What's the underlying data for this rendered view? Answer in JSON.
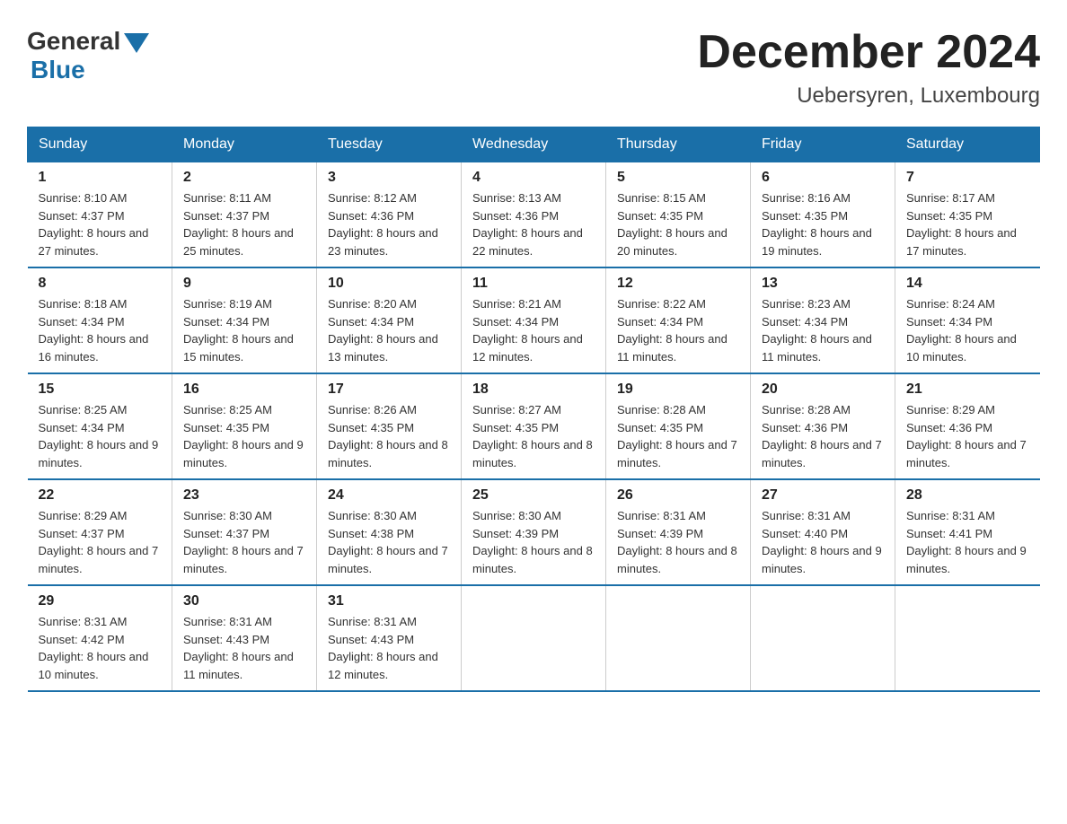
{
  "logo": {
    "general": "General",
    "blue": "Blue"
  },
  "title": "December 2024",
  "location": "Uebersyren, Luxembourg",
  "headers": [
    "Sunday",
    "Monday",
    "Tuesday",
    "Wednesday",
    "Thursday",
    "Friday",
    "Saturday"
  ],
  "weeks": [
    [
      {
        "day": "1",
        "sunrise": "8:10 AM",
        "sunset": "4:37 PM",
        "daylight": "8 hours and 27 minutes."
      },
      {
        "day": "2",
        "sunrise": "8:11 AM",
        "sunset": "4:37 PM",
        "daylight": "8 hours and 25 minutes."
      },
      {
        "day": "3",
        "sunrise": "8:12 AM",
        "sunset": "4:36 PM",
        "daylight": "8 hours and 23 minutes."
      },
      {
        "day": "4",
        "sunrise": "8:13 AM",
        "sunset": "4:36 PM",
        "daylight": "8 hours and 22 minutes."
      },
      {
        "day": "5",
        "sunrise": "8:15 AM",
        "sunset": "4:35 PM",
        "daylight": "8 hours and 20 minutes."
      },
      {
        "day": "6",
        "sunrise": "8:16 AM",
        "sunset": "4:35 PM",
        "daylight": "8 hours and 19 minutes."
      },
      {
        "day": "7",
        "sunrise": "8:17 AM",
        "sunset": "4:35 PM",
        "daylight": "8 hours and 17 minutes."
      }
    ],
    [
      {
        "day": "8",
        "sunrise": "8:18 AM",
        "sunset": "4:34 PM",
        "daylight": "8 hours and 16 minutes."
      },
      {
        "day": "9",
        "sunrise": "8:19 AM",
        "sunset": "4:34 PM",
        "daylight": "8 hours and 15 minutes."
      },
      {
        "day": "10",
        "sunrise": "8:20 AM",
        "sunset": "4:34 PM",
        "daylight": "8 hours and 13 minutes."
      },
      {
        "day": "11",
        "sunrise": "8:21 AM",
        "sunset": "4:34 PM",
        "daylight": "8 hours and 12 minutes."
      },
      {
        "day": "12",
        "sunrise": "8:22 AM",
        "sunset": "4:34 PM",
        "daylight": "8 hours and 11 minutes."
      },
      {
        "day": "13",
        "sunrise": "8:23 AM",
        "sunset": "4:34 PM",
        "daylight": "8 hours and 11 minutes."
      },
      {
        "day": "14",
        "sunrise": "8:24 AM",
        "sunset": "4:34 PM",
        "daylight": "8 hours and 10 minutes."
      }
    ],
    [
      {
        "day": "15",
        "sunrise": "8:25 AM",
        "sunset": "4:34 PM",
        "daylight": "8 hours and 9 minutes."
      },
      {
        "day": "16",
        "sunrise": "8:25 AM",
        "sunset": "4:35 PM",
        "daylight": "8 hours and 9 minutes."
      },
      {
        "day": "17",
        "sunrise": "8:26 AM",
        "sunset": "4:35 PM",
        "daylight": "8 hours and 8 minutes."
      },
      {
        "day": "18",
        "sunrise": "8:27 AM",
        "sunset": "4:35 PM",
        "daylight": "8 hours and 8 minutes."
      },
      {
        "day": "19",
        "sunrise": "8:28 AM",
        "sunset": "4:35 PM",
        "daylight": "8 hours and 7 minutes."
      },
      {
        "day": "20",
        "sunrise": "8:28 AM",
        "sunset": "4:36 PM",
        "daylight": "8 hours and 7 minutes."
      },
      {
        "day": "21",
        "sunrise": "8:29 AM",
        "sunset": "4:36 PM",
        "daylight": "8 hours and 7 minutes."
      }
    ],
    [
      {
        "day": "22",
        "sunrise": "8:29 AM",
        "sunset": "4:37 PM",
        "daylight": "8 hours and 7 minutes."
      },
      {
        "day": "23",
        "sunrise": "8:30 AM",
        "sunset": "4:37 PM",
        "daylight": "8 hours and 7 minutes."
      },
      {
        "day": "24",
        "sunrise": "8:30 AM",
        "sunset": "4:38 PM",
        "daylight": "8 hours and 7 minutes."
      },
      {
        "day": "25",
        "sunrise": "8:30 AM",
        "sunset": "4:39 PM",
        "daylight": "8 hours and 8 minutes."
      },
      {
        "day": "26",
        "sunrise": "8:31 AM",
        "sunset": "4:39 PM",
        "daylight": "8 hours and 8 minutes."
      },
      {
        "day": "27",
        "sunrise": "8:31 AM",
        "sunset": "4:40 PM",
        "daylight": "8 hours and 9 minutes."
      },
      {
        "day": "28",
        "sunrise": "8:31 AM",
        "sunset": "4:41 PM",
        "daylight": "8 hours and 9 minutes."
      }
    ],
    [
      {
        "day": "29",
        "sunrise": "8:31 AM",
        "sunset": "4:42 PM",
        "daylight": "8 hours and 10 minutes."
      },
      {
        "day": "30",
        "sunrise": "8:31 AM",
        "sunset": "4:43 PM",
        "daylight": "8 hours and 11 minutes."
      },
      {
        "day": "31",
        "sunrise": "8:31 AM",
        "sunset": "4:43 PM",
        "daylight": "8 hours and 12 minutes."
      },
      null,
      null,
      null,
      null
    ]
  ],
  "labels": {
    "sunrise_prefix": "Sunrise: ",
    "sunset_prefix": "Sunset: ",
    "daylight_prefix": "Daylight: "
  }
}
